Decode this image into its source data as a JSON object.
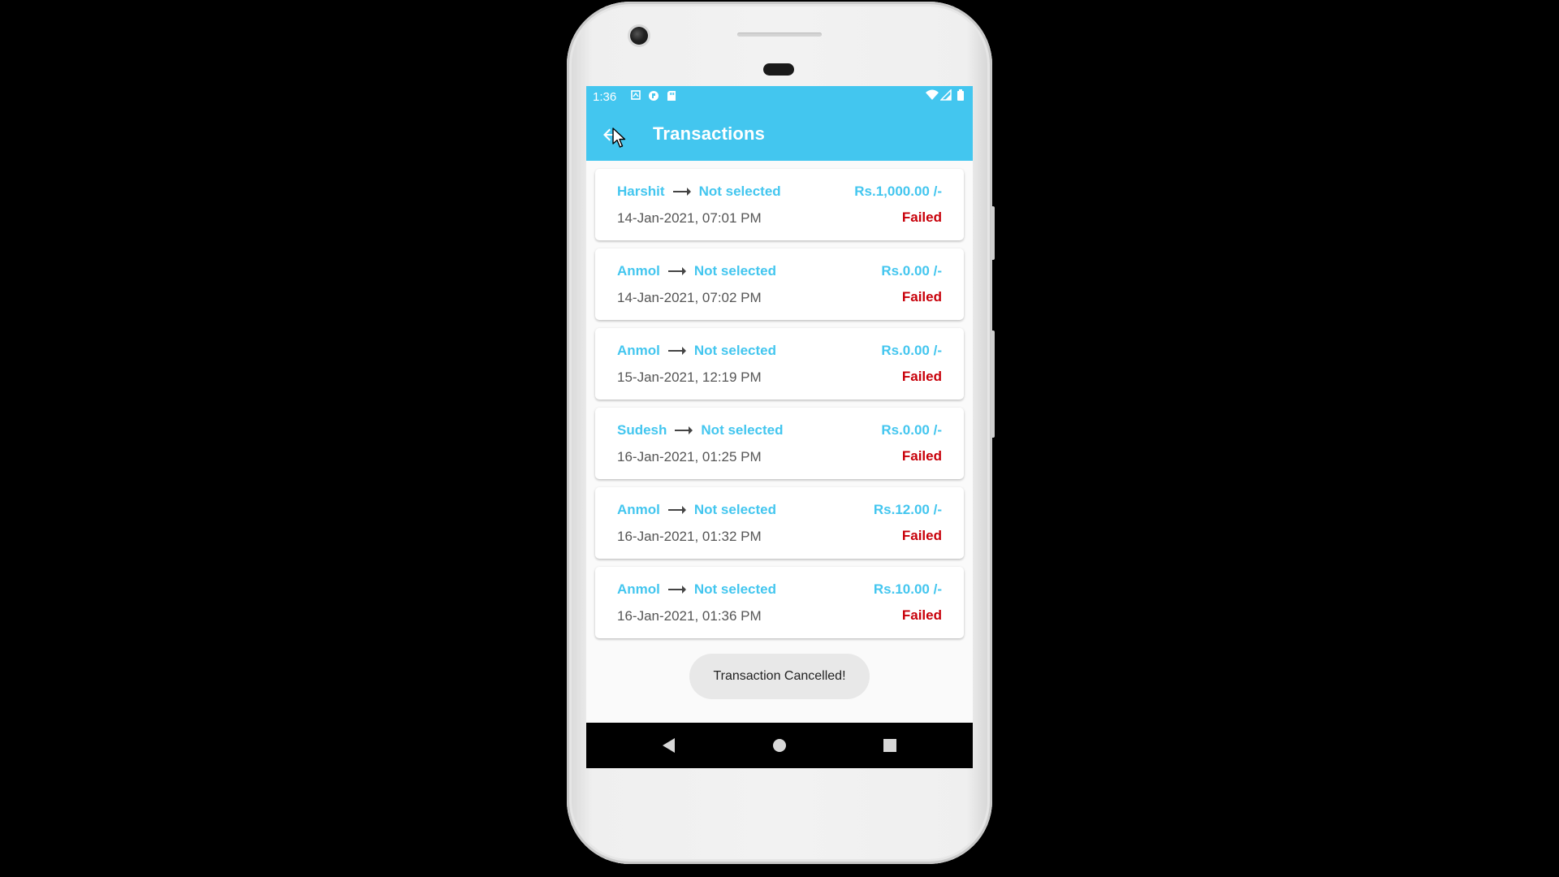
{
  "status_bar": {
    "time": "1:36",
    "left_icons": [
      "notification-icon",
      "sync-icon",
      "sd-card-icon"
    ],
    "right_icons": [
      "wifi-icon",
      "cell-signal-icon",
      "battery-icon"
    ]
  },
  "app_bar": {
    "title": "Transactions",
    "back_icon": "back-arrow-icon",
    "color": "#43c6ef"
  },
  "transactions": [
    {
      "from": "Harshit",
      "to": "Not selected",
      "amount": "Rs.1,000.00 /-",
      "date": "14-Jan-2021, 07:01 PM",
      "status": "Failed"
    },
    {
      "from": "Anmol",
      "to": "Not selected",
      "amount": "Rs.0.00 /-",
      "date": "14-Jan-2021, 07:02 PM",
      "status": "Failed"
    },
    {
      "from": "Anmol",
      "to": "Not selected",
      "amount": "Rs.0.00 /-",
      "date": "15-Jan-2021, 12:19 PM",
      "status": "Failed"
    },
    {
      "from": "Sudesh",
      "to": "Not selected",
      "amount": "Rs.0.00 /-",
      "date": "16-Jan-2021, 01:25 PM",
      "status": "Failed"
    },
    {
      "from": "Anmol",
      "to": "Not selected",
      "amount": "Rs.12.00 /-",
      "date": "16-Jan-2021, 01:32 PM",
      "status": "Failed"
    },
    {
      "from": "Anmol",
      "to": "Not selected",
      "amount": "Rs.10.00 /-",
      "date": "16-Jan-2021, 01:36 PM",
      "status": "Failed"
    }
  ],
  "toast": {
    "message": "Transaction Cancelled!"
  },
  "nav_bar": {
    "buttons": [
      "nav-back-icon",
      "nav-home-icon",
      "nav-recents-icon"
    ]
  },
  "colors": {
    "accent": "#43c6ef",
    "failed": "#c8000a",
    "date_text": "#555555"
  }
}
